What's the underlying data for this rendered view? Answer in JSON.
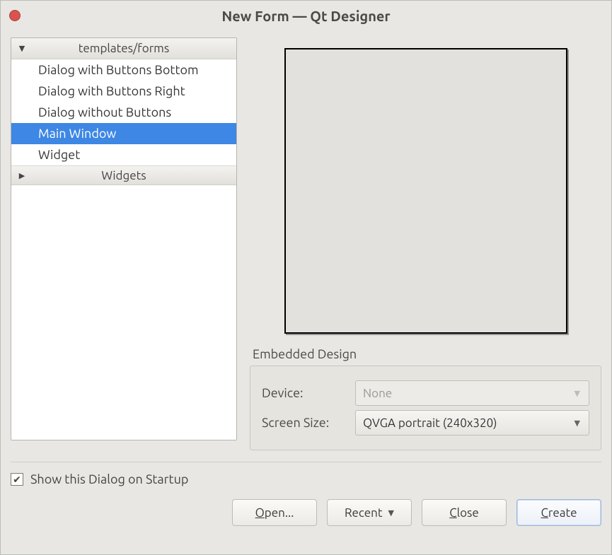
{
  "window": {
    "title": "New Form — Qt Designer"
  },
  "tree": {
    "group_forms": {
      "label": "templates/forms",
      "expanded": true
    },
    "items": [
      {
        "label": "Dialog with Buttons Bottom",
        "selected": false
      },
      {
        "label": "Dialog with Buttons Right",
        "selected": false
      },
      {
        "label": "Dialog without Buttons",
        "selected": false
      },
      {
        "label": "Main Window",
        "selected": true
      },
      {
        "label": "Widget",
        "selected": false
      }
    ],
    "group_widgets": {
      "label": "Widgets",
      "expanded": false
    }
  },
  "embedded": {
    "title": "Embedded Design",
    "device_label": "Device:",
    "device_value": "None",
    "device_enabled": false,
    "size_label": "Screen Size:",
    "size_value": "QVGA portrait (240x320)"
  },
  "startup": {
    "checked": true,
    "label": "Show this Dialog on Startup"
  },
  "buttons": {
    "open": "Open...",
    "open_accel": "O",
    "recent": "Recent",
    "close": "Close",
    "close_accel": "C",
    "create": "Create",
    "create_accel": "C"
  }
}
